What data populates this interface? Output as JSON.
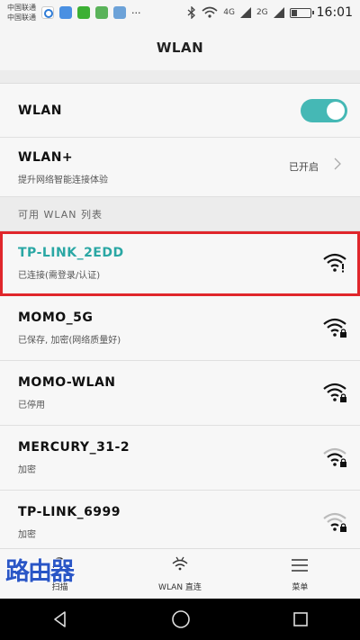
{
  "status_bar": {
    "carrier_1": "中国联通",
    "carrier_2": "中国联通",
    "network_1": "4G",
    "network_2": "2G",
    "time": "16:01",
    "app_icons": [
      "baidu-icon",
      "cloud-icon",
      "wechat-icon",
      "chart-icon",
      "gallery-icon"
    ],
    "more": "···"
  },
  "title": "WLAN",
  "wlan_toggle": {
    "label": "WLAN",
    "enabled": true,
    "accent": "#45b8b5"
  },
  "wlan_plus": {
    "label": "WLAN+",
    "subtitle": "提升网络智能连接体验",
    "state": "已开启"
  },
  "available_header": "可用 WLAN 列表",
  "networks": [
    {
      "ssid": "TP-LINK_2EDD",
      "status": "已连接(需登录/认证)",
      "connected": true,
      "secured": false,
      "signal": "strong"
    },
    {
      "ssid": "MOMO_5G",
      "status": "已保存, 加密(网络质量好)",
      "connected": false,
      "secured": true,
      "signal": "strong"
    },
    {
      "ssid": "MOMO-WLAN",
      "status": "已停用",
      "connected": false,
      "secured": true,
      "signal": "strong"
    },
    {
      "ssid": "MERCURY_31-2",
      "status": "加密",
      "connected": false,
      "secured": true,
      "signal": "medium"
    },
    {
      "ssid": "TP-LINK_6999",
      "status": "加密",
      "connected": false,
      "secured": true,
      "signal": "weak"
    }
  ],
  "bottom_bar": {
    "scan": "扫描",
    "wlan_direct": "WLAN 直连",
    "menu": "菜单"
  },
  "watermark": "路由器",
  "highlight_color": "#e0262b"
}
